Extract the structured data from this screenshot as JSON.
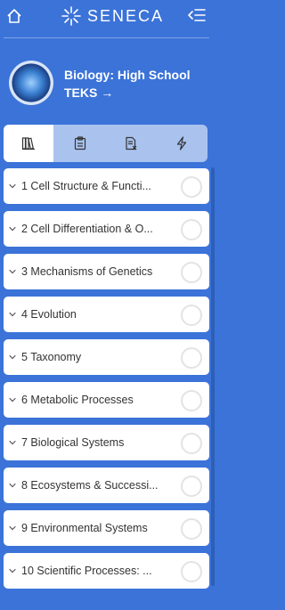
{
  "app": {
    "name": "SENECA"
  },
  "course": {
    "title": "Biology: High School TEKS →"
  },
  "tabs": [
    {
      "name": "books-icon",
      "active": true
    },
    {
      "name": "clipboard-icon",
      "active": false
    },
    {
      "name": "document-x-icon",
      "active": false
    },
    {
      "name": "lightning-icon",
      "active": false
    }
  ],
  "topics": [
    {
      "label": "1 Cell Structure & Functi..."
    },
    {
      "label": "2 Cell Differentiation & O..."
    },
    {
      "label": "3 Mechanisms of Genetics"
    },
    {
      "label": "4 Evolution"
    },
    {
      "label": "5 Taxonomy"
    },
    {
      "label": "6 Metabolic Processes"
    },
    {
      "label": "7 Biological Systems"
    },
    {
      "label": "8 Ecosystems & Successi..."
    },
    {
      "label": "9 Environmental Systems"
    },
    {
      "label": "10 Scientific Processes: ..."
    }
  ],
  "colors": {
    "background": "#3b73d8",
    "tab_bar": "#a9c2ee"
  }
}
